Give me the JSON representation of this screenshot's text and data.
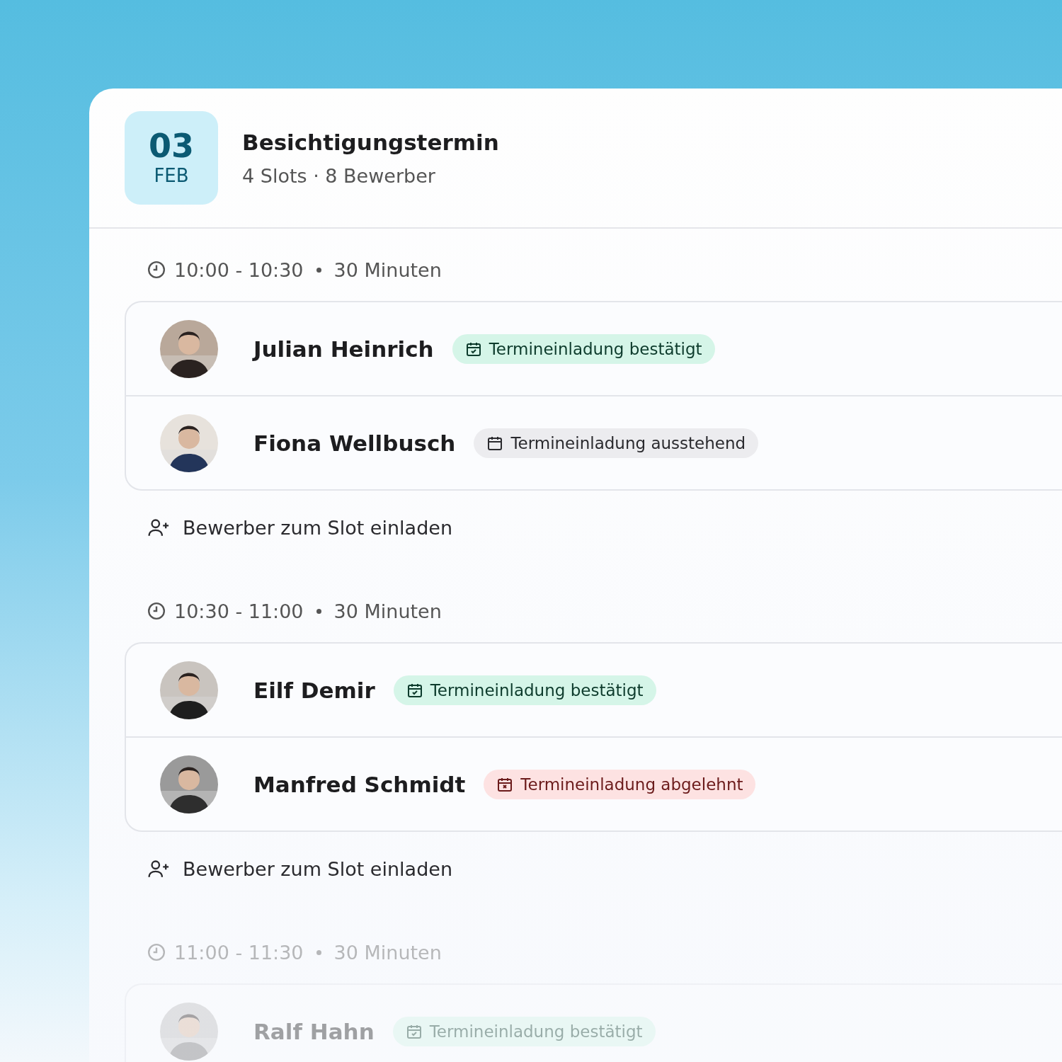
{
  "event": {
    "day": "03",
    "month": "FEB",
    "title": "Besichtigungstermin",
    "summary": "4 Slots · 8 Bewerber"
  },
  "slots": [
    {
      "time": "10:00 - 10:30",
      "duration": "30 Minuten",
      "faded": false,
      "applicants": [
        {
          "name": "Julian Heinrich",
          "kind": "confirmed",
          "badge": "Termineinladung bestätigt"
        },
        {
          "name": "Fiona Wellbusch",
          "kind": "pending",
          "badge": "Termineinladung ausstehend"
        }
      ],
      "invite": "Bewerber zum Slot einladen"
    },
    {
      "time": "10:30 - 11:00",
      "duration": "30 Minuten",
      "faded": false,
      "applicants": [
        {
          "name": "Eilf Demir",
          "kind": "confirmed",
          "badge": "Termineinladung bestätigt"
        },
        {
          "name": "Manfred Schmidt",
          "kind": "declined",
          "badge": "Termineinladung abgelehnt"
        }
      ],
      "invite": "Bewerber zum Slot einladen"
    },
    {
      "time": "11:00 - 11:30",
      "duration": "30 Minuten",
      "faded": true,
      "applicants": [
        {
          "name": "Ralf Hahn",
          "kind": "confirmed",
          "badge": "Termineinladung bestätigt"
        }
      ]
    }
  ]
}
